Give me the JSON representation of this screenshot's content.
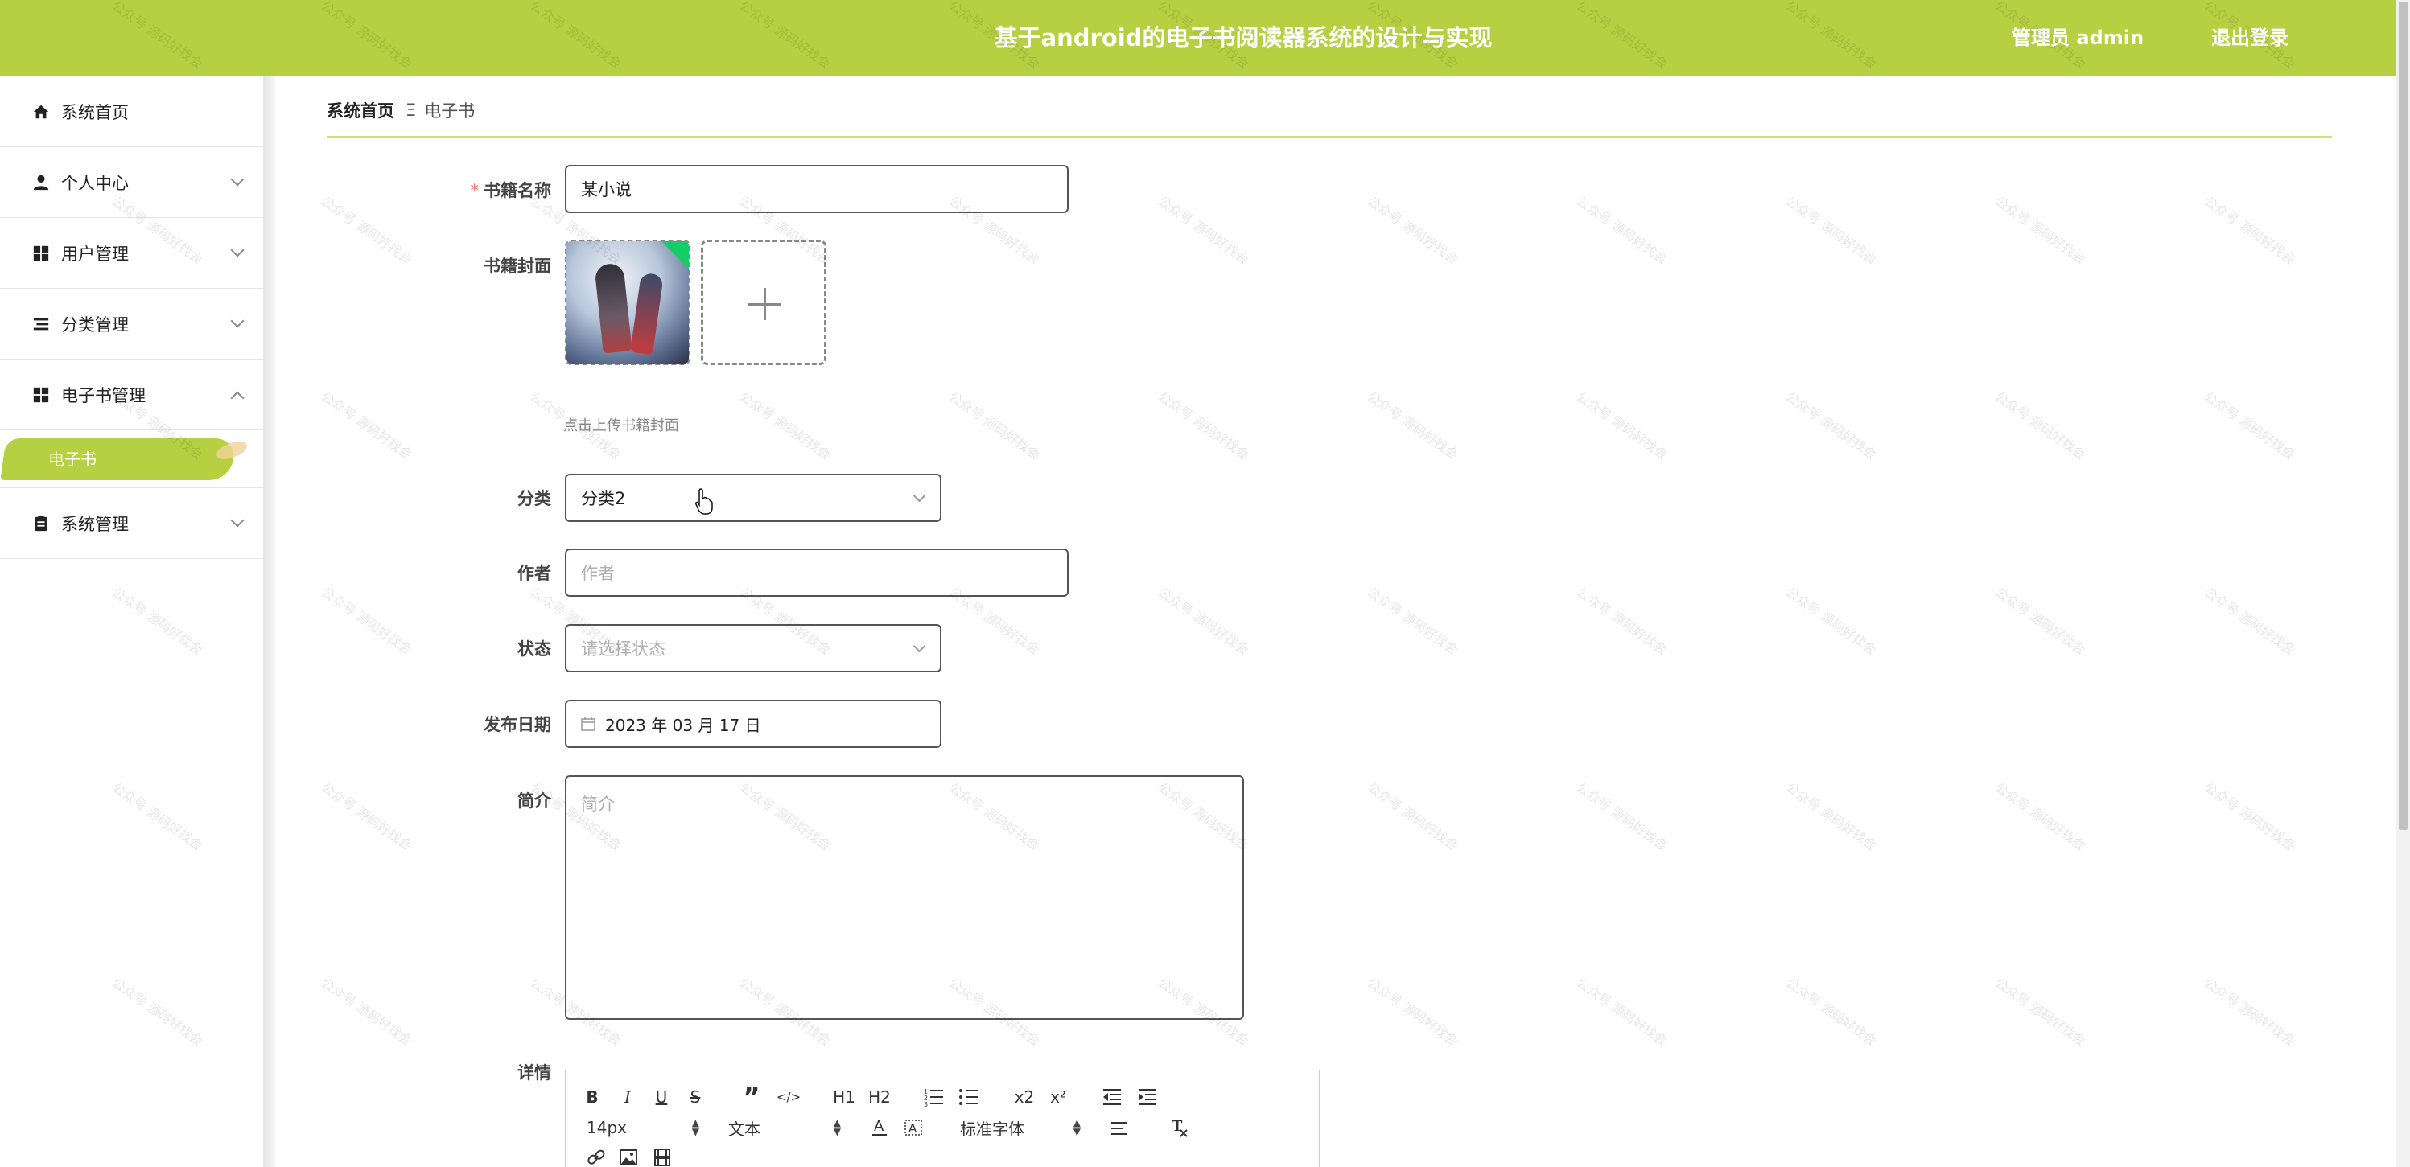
{
  "header": {
    "title": "基于android的电子书阅读器系统的设计与实现",
    "user": "管理员 admin",
    "logout": "退出登录"
  },
  "sidebar": {
    "items": [
      {
        "label": "系统首页",
        "icon": "home-icon"
      },
      {
        "label": "个人中心",
        "icon": "user-icon"
      },
      {
        "label": "用户管理",
        "icon": "grid-icon"
      },
      {
        "label": "分类管理",
        "icon": "list-icon"
      },
      {
        "label": "电子书管理",
        "icon": "grid-icon"
      },
      {
        "label": "系统管理",
        "icon": "clipboard-icon"
      }
    ],
    "sub_active": "电子书"
  },
  "breadcrumb": {
    "home": "系统首页",
    "separator": "Ξ",
    "current": "电子书"
  },
  "form": {
    "name_label": "书籍名称",
    "name_value": "某小说",
    "cover_label": "书籍封面",
    "cover_hint": "点击上传书籍封面",
    "category_label": "分类",
    "category_value": "分类2",
    "author_label": "作者",
    "author_placeholder": "作者",
    "status_label": "状态",
    "status_placeholder": "请选择状态",
    "date_label": "发布日期",
    "date_value": "2023 年 03 月 17 日",
    "intro_label": "简介",
    "intro_placeholder": "简介",
    "detail_label": "详情"
  },
  "editor": {
    "font_size": "14px",
    "text_type": "文本",
    "font_family": "标准字体",
    "buttons": [
      "B",
      "I",
      "U",
      "S",
      "”",
      "</>",
      "H1",
      "H2",
      "ol",
      "ul",
      "x2",
      "x²",
      "outdent",
      "indent"
    ]
  },
  "watermark": "公众号 源码好找会",
  "colors": {
    "accent": "#b6d042",
    "border": "#555555"
  }
}
